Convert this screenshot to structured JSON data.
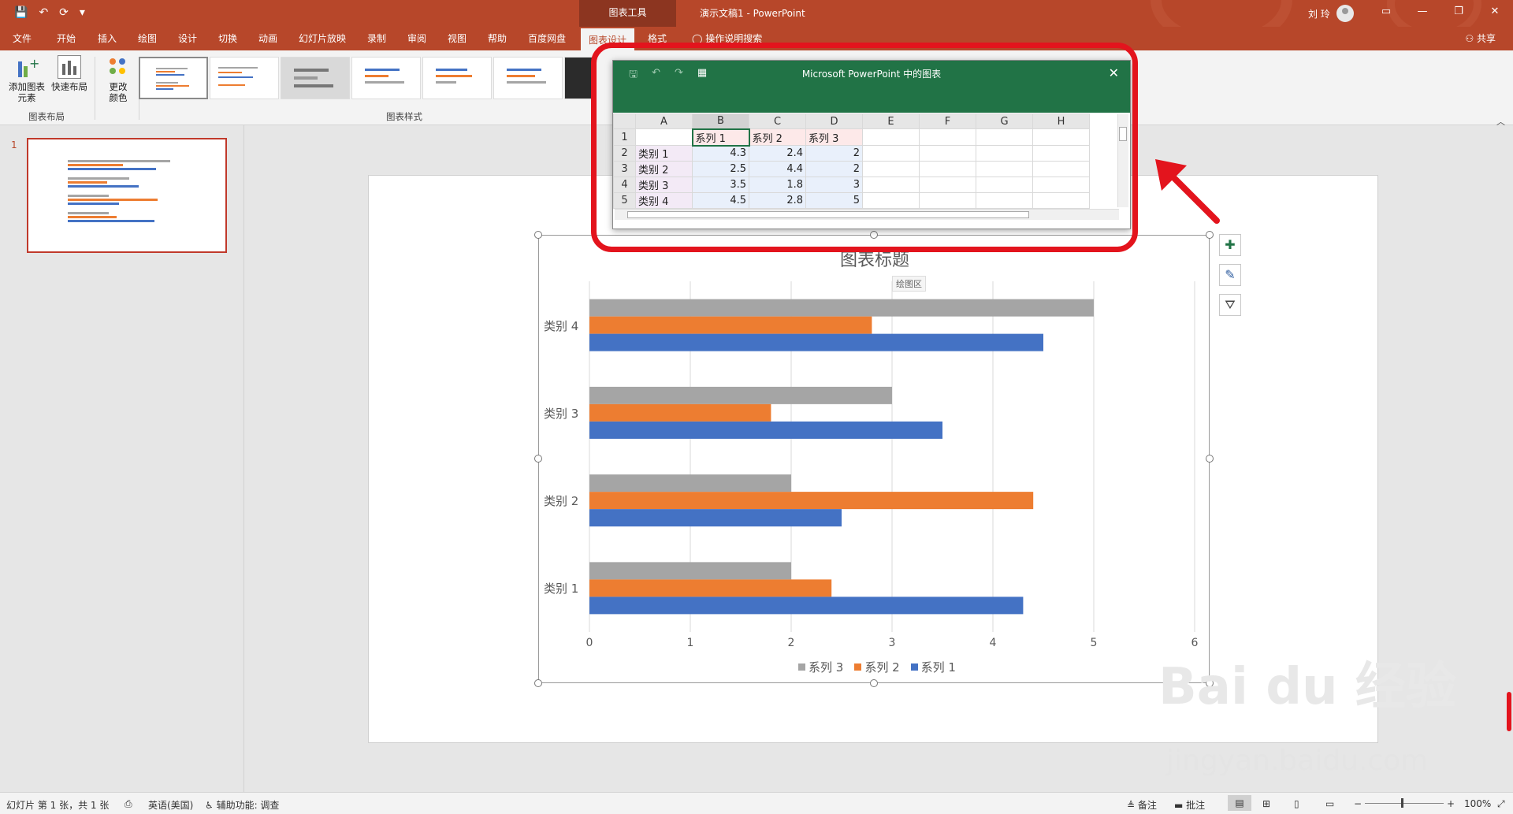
{
  "titlebar": {
    "context_tools": "图表工具",
    "doc_title": "演示文稿1  -  PowerPoint",
    "user": "刘 玲",
    "qat": [
      "💾",
      "↶",
      "⟳",
      "▾"
    ]
  },
  "tabs": {
    "items": [
      {
        "label": "文件"
      },
      {
        "label": "开始"
      },
      {
        "label": "插入"
      },
      {
        "label": "绘图"
      },
      {
        "label": "设计"
      },
      {
        "label": "切换"
      },
      {
        "label": "动画"
      },
      {
        "label": "幻灯片放映"
      },
      {
        "label": "录制"
      },
      {
        "label": "审阅"
      },
      {
        "label": "视图"
      },
      {
        "label": "帮助"
      },
      {
        "label": "百度网盘"
      },
      {
        "label": "图表设计"
      },
      {
        "label": "格式"
      }
    ],
    "search": "操作说明搜索",
    "share": "共享"
  },
  "ribbon": {
    "add_element": "添加图表\n元素",
    "quick_layout": "快速布局",
    "change_colors": "更改\n颜色",
    "group_layout": "图表布局",
    "group_styles": "图表样式"
  },
  "sidebar": {
    "slide_number": "1"
  },
  "excel": {
    "title": "Microsoft PowerPoint 中的图表",
    "columns": [
      "A",
      "B",
      "C",
      "D",
      "E",
      "F",
      "G",
      "H"
    ],
    "rows": [
      {
        "n": "1",
        "a": "",
        "b": "系列 1",
        "c": "系列 2",
        "d": "系列 3"
      },
      {
        "n": "2",
        "a": "类别 1",
        "b": "4.3",
        "c": "2.4",
        "d": "2"
      },
      {
        "n": "3",
        "a": "类别 2",
        "b": "2.5",
        "c": "4.4",
        "d": "2"
      },
      {
        "n": "4",
        "a": "类别 3",
        "b": "3.5",
        "c": "1.8",
        "d": "3"
      },
      {
        "n": "5",
        "a": "类别 4",
        "b": "4.5",
        "c": "2.8",
        "d": "5"
      }
    ]
  },
  "chart_tooltip": "绘图区",
  "chart_data": {
    "type": "bar",
    "orientation": "horizontal",
    "title": "图表标题",
    "categories": [
      "类别 1",
      "类别 2",
      "类别 3",
      "类别 4"
    ],
    "series": [
      {
        "name": "系列 1",
        "values": [
          4.3,
          2.5,
          3.5,
          4.5
        ],
        "color": "#4472c4"
      },
      {
        "name": "系列 2",
        "values": [
          2.4,
          4.4,
          1.8,
          2.8
        ],
        "color": "#ed7d31"
      },
      {
        "name": "系列 3",
        "values": [
          2,
          2,
          3,
          5
        ],
        "color": "#a5a5a5"
      }
    ],
    "xlim": [
      0,
      6
    ],
    "ticks": [
      "0",
      "1",
      "2",
      "3",
      "4",
      "5",
      "6"
    ],
    "grid": true,
    "legend_position": "bottom"
  },
  "statusbar": {
    "slide_info": "幻灯片 第 1 张，共 1 张",
    "language": "英语(美国)",
    "accessibility": "辅助功能: 调查",
    "notes": "备注",
    "comments": "批注",
    "zoom": "100%"
  },
  "watermark": {
    "brand": "Bai du 经验",
    "url": "jingyan.baidu.com"
  }
}
